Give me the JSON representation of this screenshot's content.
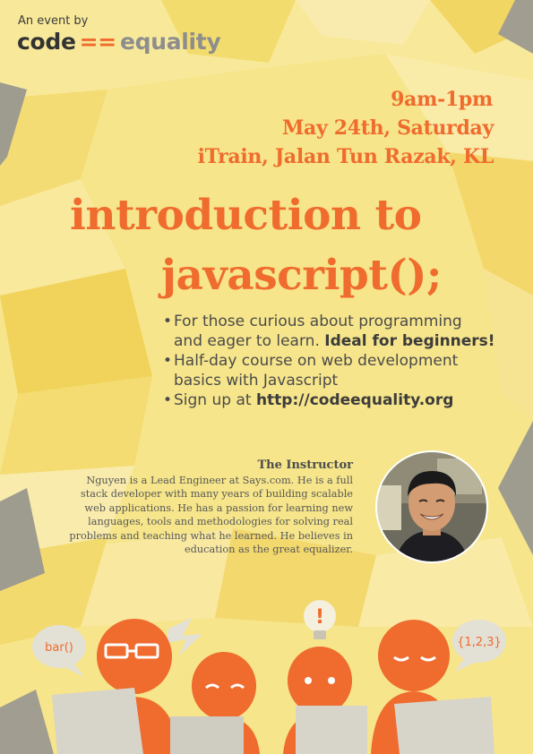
{
  "brand": {
    "prefix": "An event by",
    "word1": "code",
    "operator": "==",
    "word2": "equality"
  },
  "event": {
    "time": "9am-1pm",
    "date": "May 24th, Saturday",
    "venue": "iTrain, Jalan Tun Razak, KL"
  },
  "title": {
    "line1": "introduction to",
    "line2": "javascript();"
  },
  "bullets": [
    {
      "line1": "For those curious about programming",
      "line2_plain": "and eager to learn. ",
      "line2_bold": "Ideal for beginners!"
    },
    {
      "line1": "Half-day course on web development",
      "line2_plain": "basics with Javascript",
      "line2_bold": ""
    },
    {
      "line1_plain": "Sign up at ",
      "line1_bold": "http://codeequality.org"
    }
  ],
  "instructor": {
    "heading": "The Instructor",
    "bio": [
      "Nguyen is a Lead Engineer at Says.com. He is a full",
      "stack developer with many years of building scalable",
      "web applications. He has a passion for learning new",
      "languages, tools and methodologies for solving real",
      "problems and teaching what he learned. He believes in",
      "education as the great equalizer."
    ]
  },
  "illustration": {
    "bubble_left": "bar()",
    "bubble_right": "{1,2,3}",
    "bulb_mark": "!"
  },
  "colors": {
    "background": "#f6e58a",
    "accent_orange": "#ef6b2e",
    "text_dark": "#4b4b4b",
    "gray_shape": "#9e9b8f"
  },
  "icons": [
    "lightbulb-icon",
    "lightning-icon",
    "speech-bubble-icon",
    "laptop-icon"
  ]
}
